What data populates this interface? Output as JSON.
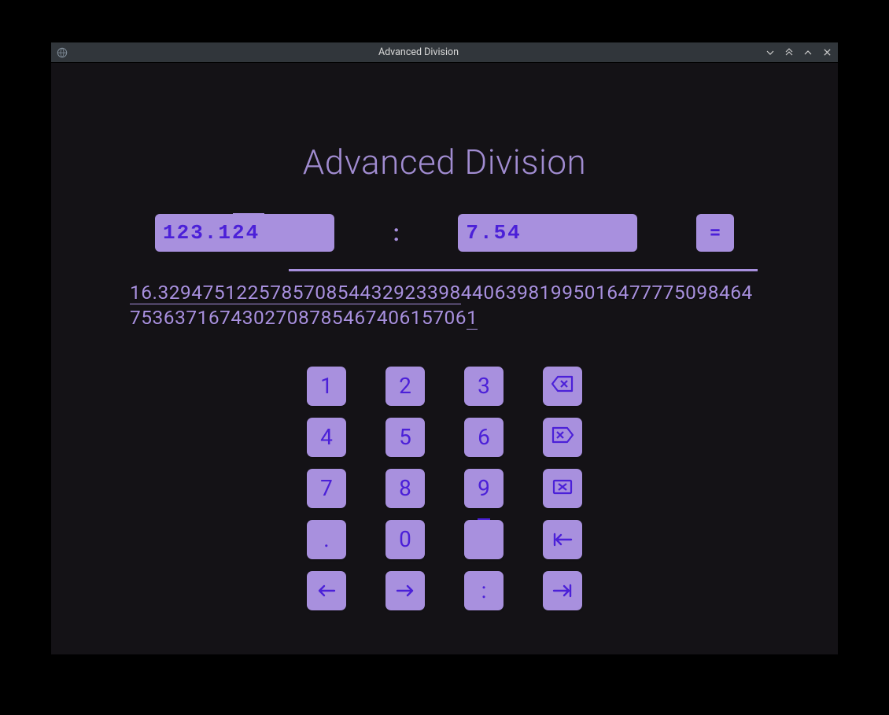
{
  "window": {
    "title": "Advanced Division"
  },
  "heading": "Advanced Division",
  "inputs": {
    "dividend": {
      "int_part": "123.1",
      "period_part": "24"
    },
    "divisor": {
      "value": "7.54"
    },
    "separator": ":",
    "equals_label": "="
  },
  "result": {
    "selected_prefix": "16.329475122578570854432923398",
    "rest": "44063981995016477775098464753637167430270878546740615706",
    "overline_end": "1"
  },
  "keypad": {
    "k1": "1",
    "k2": "2",
    "k3": "3",
    "k4": "4",
    "k5": "5",
    "k6": "6",
    "k7": "7",
    "k8": "8",
    "k9": "9",
    "dot": ".",
    "k0": "0",
    "colon": ":"
  }
}
